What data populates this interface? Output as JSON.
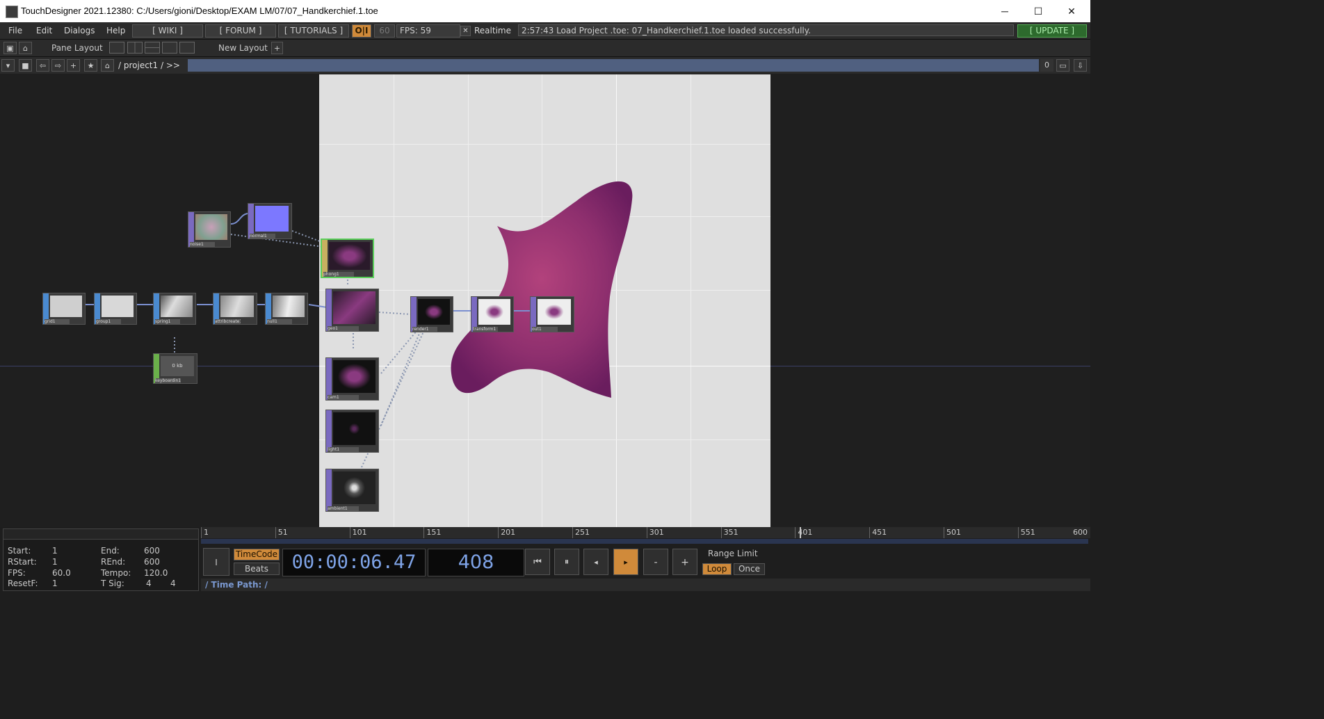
{
  "window": {
    "title": "TouchDesigner 2021.12380: C:/Users/gioni/Desktop/EXAM LM/07/07_Handkerchief.1.toe",
    "minimize": "─",
    "maximize": "☐",
    "close": "✕"
  },
  "menu": {
    "file": "File",
    "edit": "Edit",
    "dialogs": "Dialogs",
    "help": "Help",
    "wiki": "[ WIKI ]",
    "forum": "[ FORUM ]",
    "tutorials": "[ TUTORIALS ]",
    "oi": "O|I",
    "fps_cap": "60",
    "fps": "FPS:  59",
    "realtime_check": "✕",
    "realtime": "Realtime",
    "status": "2:57:43 Load Project .toe: 07_Handkerchief.1.toe loaded successfully.",
    "update": "[ UPDATE ]"
  },
  "panebar": {
    "pane_layout": "Pane Layout",
    "new_layout": "New Layout",
    "plus": "+"
  },
  "pathbar": {
    "path": "/ project1 / >>",
    "zero": "0"
  },
  "nodes": [
    {
      "id": "noise1",
      "label": "noise1",
      "type": "TOP"
    },
    {
      "id": "normal1",
      "label": "normal1",
      "type": "TOP"
    },
    {
      "id": "phong1",
      "label": "phong1",
      "type": "MAT"
    },
    {
      "id": "grid1",
      "label": "grid1",
      "type": "SOP"
    },
    {
      "id": "group1",
      "label": "group1",
      "type": "SOP"
    },
    {
      "id": "spring1",
      "label": "spring1",
      "type": "SOP"
    },
    {
      "id": "attribcreate1",
      "label": "attribcreate1",
      "type": "SOP"
    },
    {
      "id": "null1",
      "label": "null1",
      "type": "SOP"
    },
    {
      "id": "keyboardin1",
      "label": "keyboardin1",
      "type": "CHOP",
      "value": "0 kb"
    },
    {
      "id": "geo1",
      "label": "geo1",
      "type": "COMP"
    },
    {
      "id": "cam1",
      "label": "cam1",
      "type": "COMP"
    },
    {
      "id": "light1",
      "label": "light1",
      "type": "COMP"
    },
    {
      "id": "ambient1",
      "label": "ambient1",
      "type": "COMP"
    },
    {
      "id": "render1",
      "label": "render1",
      "type": "TOP"
    },
    {
      "id": "transform1",
      "label": "transform1",
      "type": "TOP"
    },
    {
      "id": "out1",
      "label": "out1",
      "type": "TOP"
    }
  ],
  "timeline": {
    "start_label": "Start:",
    "start": "1",
    "end_label": "End:",
    "end": "600",
    "rstart_label": "RStart:",
    "rstart": "1",
    "rend_label": "REnd:",
    "rend": "600",
    "fps_label": "FPS:",
    "fps": "60.0",
    "tempo_label": "Tempo:",
    "tempo": "120.0",
    "resetf_label": "ResetF:",
    "resetf": "1",
    "tsig_label": "T Sig:",
    "tsig_a": "4",
    "tsig_b": "4",
    "ticks": [
      "1",
      "51",
      "101",
      "151",
      "201",
      "251",
      "301",
      "351",
      "401",
      "451",
      "501",
      "551",
      "600"
    ],
    "timecode_btn": "TimeCode",
    "beats_btn": "Beats",
    "timecode": "00:00:06.47",
    "frame": "408",
    "range_limit": "Range Limit",
    "loop": "Loop",
    "once": "Once",
    "minus": "-",
    "plus": "+",
    "time_path": "/   Time Path: /"
  },
  "colors": {
    "accent_orange": "#d08a3a",
    "sop_blue": "#4a8ad0",
    "top_purple": "#7a6ac0",
    "mat_yellow": "#c8b060",
    "chop_green": "#6ab04a",
    "update_green": "#2d6a2d"
  }
}
